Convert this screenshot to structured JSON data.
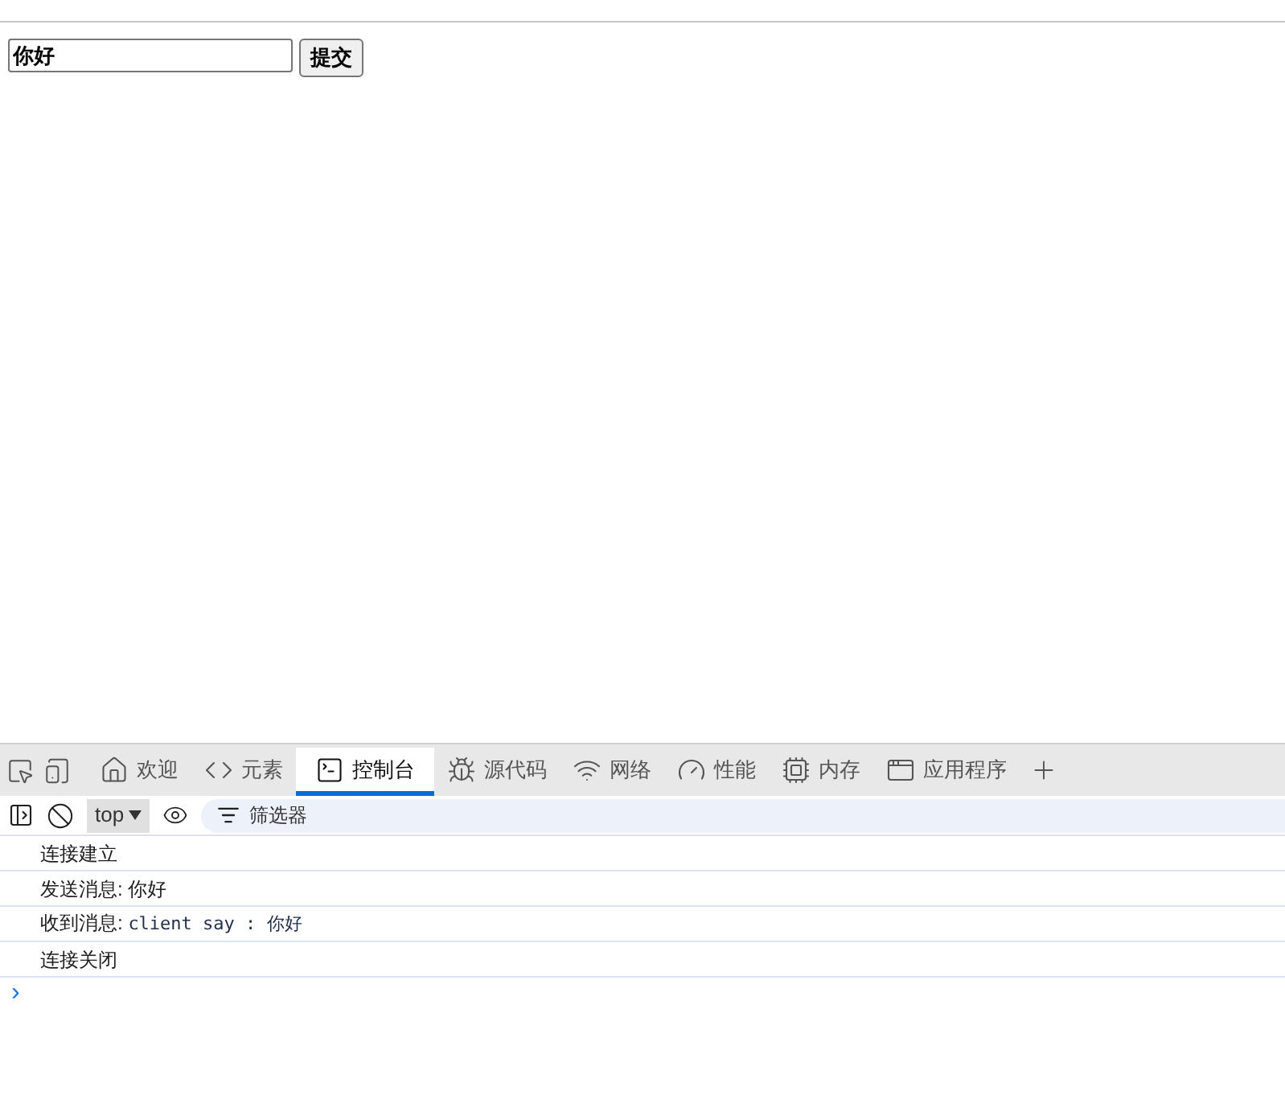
{
  "page": {
    "input": {
      "value": "你好"
    },
    "submit_button": "提交"
  },
  "devtools": {
    "tabs": [
      {
        "kind": "welcome",
        "label": "欢迎",
        "selected": false
      },
      {
        "kind": "elements",
        "label": "元素",
        "selected": false
      },
      {
        "kind": "console",
        "label": "控制台",
        "selected": true
      },
      {
        "kind": "sources",
        "label": "源代码",
        "selected": false
      },
      {
        "kind": "network",
        "label": "网络",
        "selected": false
      },
      {
        "kind": "performance",
        "label": "性能",
        "selected": false
      },
      {
        "kind": "memory",
        "label": "内存",
        "selected": false
      },
      {
        "kind": "application",
        "label": "应用程序",
        "selected": false
      }
    ],
    "toolbar": {
      "context": "top",
      "filter": {
        "placeholder": "筛选器"
      }
    },
    "console": {
      "messages": [
        {
          "kind": "text",
          "text": "连接建立"
        },
        {
          "kind": "text",
          "text": "发送消息: 你好"
        },
        {
          "kind": "value",
          "label": "收到消息:",
          "value": "client say : 你好"
        },
        {
          "kind": "text",
          "text": "连接关闭"
        }
      ],
      "prompt": "›"
    }
  }
}
